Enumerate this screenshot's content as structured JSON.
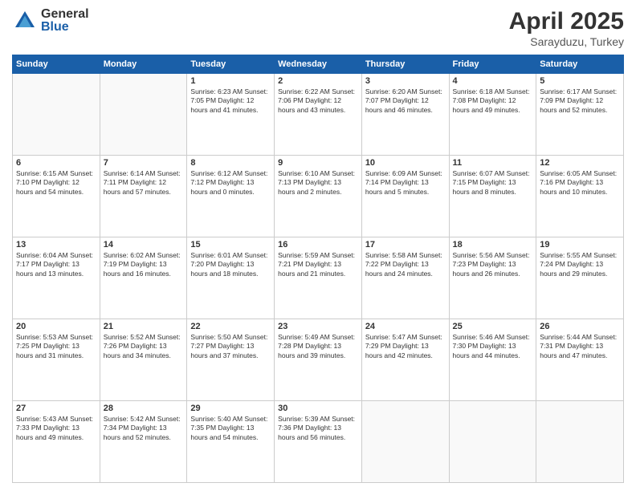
{
  "header": {
    "logo_general": "General",
    "logo_blue": "Blue",
    "month_title": "April 2025",
    "subtitle": "Sarayduzu, Turkey"
  },
  "weekdays": [
    "Sunday",
    "Monday",
    "Tuesday",
    "Wednesday",
    "Thursday",
    "Friday",
    "Saturday"
  ],
  "weeks": [
    [
      {
        "day": "",
        "info": ""
      },
      {
        "day": "",
        "info": ""
      },
      {
        "day": "1",
        "info": "Sunrise: 6:23 AM\nSunset: 7:05 PM\nDaylight: 12 hours and 41 minutes."
      },
      {
        "day": "2",
        "info": "Sunrise: 6:22 AM\nSunset: 7:06 PM\nDaylight: 12 hours and 43 minutes."
      },
      {
        "day": "3",
        "info": "Sunrise: 6:20 AM\nSunset: 7:07 PM\nDaylight: 12 hours and 46 minutes."
      },
      {
        "day": "4",
        "info": "Sunrise: 6:18 AM\nSunset: 7:08 PM\nDaylight: 12 hours and 49 minutes."
      },
      {
        "day": "5",
        "info": "Sunrise: 6:17 AM\nSunset: 7:09 PM\nDaylight: 12 hours and 52 minutes."
      }
    ],
    [
      {
        "day": "6",
        "info": "Sunrise: 6:15 AM\nSunset: 7:10 PM\nDaylight: 12 hours and 54 minutes."
      },
      {
        "day": "7",
        "info": "Sunrise: 6:14 AM\nSunset: 7:11 PM\nDaylight: 12 hours and 57 minutes."
      },
      {
        "day": "8",
        "info": "Sunrise: 6:12 AM\nSunset: 7:12 PM\nDaylight: 13 hours and 0 minutes."
      },
      {
        "day": "9",
        "info": "Sunrise: 6:10 AM\nSunset: 7:13 PM\nDaylight: 13 hours and 2 minutes."
      },
      {
        "day": "10",
        "info": "Sunrise: 6:09 AM\nSunset: 7:14 PM\nDaylight: 13 hours and 5 minutes."
      },
      {
        "day": "11",
        "info": "Sunrise: 6:07 AM\nSunset: 7:15 PM\nDaylight: 13 hours and 8 minutes."
      },
      {
        "day": "12",
        "info": "Sunrise: 6:05 AM\nSunset: 7:16 PM\nDaylight: 13 hours and 10 minutes."
      }
    ],
    [
      {
        "day": "13",
        "info": "Sunrise: 6:04 AM\nSunset: 7:17 PM\nDaylight: 13 hours and 13 minutes."
      },
      {
        "day": "14",
        "info": "Sunrise: 6:02 AM\nSunset: 7:19 PM\nDaylight: 13 hours and 16 minutes."
      },
      {
        "day": "15",
        "info": "Sunrise: 6:01 AM\nSunset: 7:20 PM\nDaylight: 13 hours and 18 minutes."
      },
      {
        "day": "16",
        "info": "Sunrise: 5:59 AM\nSunset: 7:21 PM\nDaylight: 13 hours and 21 minutes."
      },
      {
        "day": "17",
        "info": "Sunrise: 5:58 AM\nSunset: 7:22 PM\nDaylight: 13 hours and 24 minutes."
      },
      {
        "day": "18",
        "info": "Sunrise: 5:56 AM\nSunset: 7:23 PM\nDaylight: 13 hours and 26 minutes."
      },
      {
        "day": "19",
        "info": "Sunrise: 5:55 AM\nSunset: 7:24 PM\nDaylight: 13 hours and 29 minutes."
      }
    ],
    [
      {
        "day": "20",
        "info": "Sunrise: 5:53 AM\nSunset: 7:25 PM\nDaylight: 13 hours and 31 minutes."
      },
      {
        "day": "21",
        "info": "Sunrise: 5:52 AM\nSunset: 7:26 PM\nDaylight: 13 hours and 34 minutes."
      },
      {
        "day": "22",
        "info": "Sunrise: 5:50 AM\nSunset: 7:27 PM\nDaylight: 13 hours and 37 minutes."
      },
      {
        "day": "23",
        "info": "Sunrise: 5:49 AM\nSunset: 7:28 PM\nDaylight: 13 hours and 39 minutes."
      },
      {
        "day": "24",
        "info": "Sunrise: 5:47 AM\nSunset: 7:29 PM\nDaylight: 13 hours and 42 minutes."
      },
      {
        "day": "25",
        "info": "Sunrise: 5:46 AM\nSunset: 7:30 PM\nDaylight: 13 hours and 44 minutes."
      },
      {
        "day": "26",
        "info": "Sunrise: 5:44 AM\nSunset: 7:31 PM\nDaylight: 13 hours and 47 minutes."
      }
    ],
    [
      {
        "day": "27",
        "info": "Sunrise: 5:43 AM\nSunset: 7:33 PM\nDaylight: 13 hours and 49 minutes."
      },
      {
        "day": "28",
        "info": "Sunrise: 5:42 AM\nSunset: 7:34 PM\nDaylight: 13 hours and 52 minutes."
      },
      {
        "day": "29",
        "info": "Sunrise: 5:40 AM\nSunset: 7:35 PM\nDaylight: 13 hours and 54 minutes."
      },
      {
        "day": "30",
        "info": "Sunrise: 5:39 AM\nSunset: 7:36 PM\nDaylight: 13 hours and 56 minutes."
      },
      {
        "day": "",
        "info": ""
      },
      {
        "day": "",
        "info": ""
      },
      {
        "day": "",
        "info": ""
      }
    ]
  ]
}
